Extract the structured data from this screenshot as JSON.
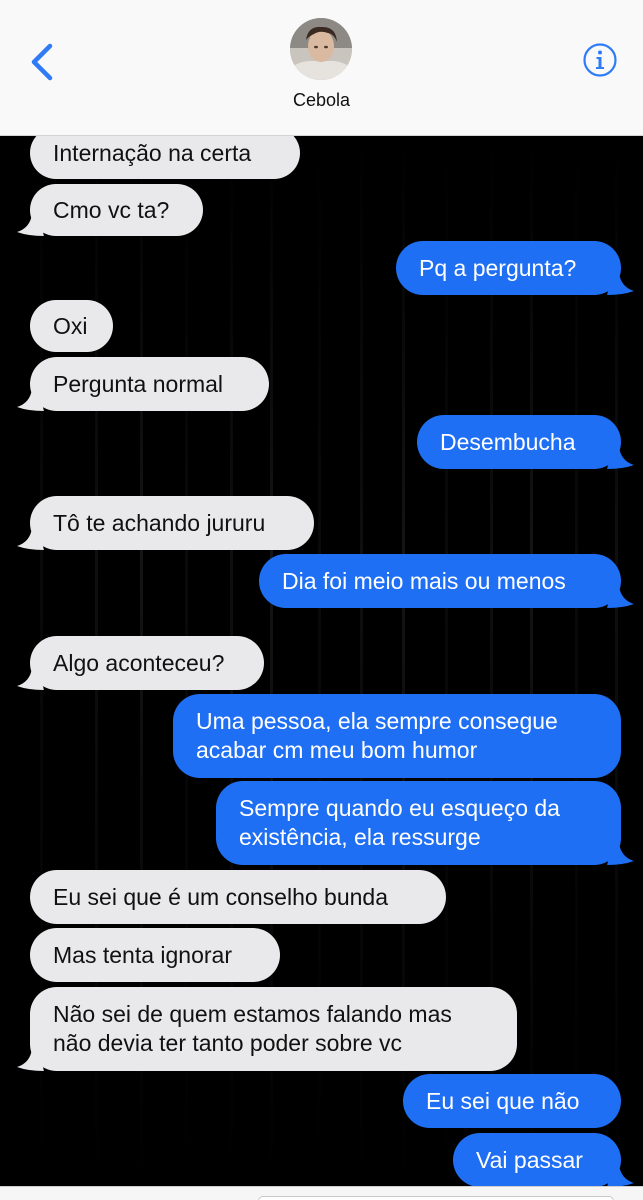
{
  "header": {
    "contact_name": "Cebola",
    "back_icon": "chevron-left-icon",
    "info_icon": "info-icon",
    "accent": "#2f7cf6"
  },
  "messages": [
    {
      "side": "in",
      "text": "Internação na certa"
    },
    {
      "side": "in",
      "text": "Cmo vc ta?"
    },
    {
      "side": "out",
      "text": "Pq a pergunta?"
    },
    {
      "side": "in",
      "text": "Oxi"
    },
    {
      "side": "in",
      "text": "Pergunta normal"
    },
    {
      "side": "out",
      "text": "Desembucha"
    },
    {
      "side": "in",
      "text": "Tô te achando jururu"
    },
    {
      "side": "out",
      "text": "Dia foi meio mais ou menos"
    },
    {
      "side": "in",
      "text": "Algo aconteceu?"
    },
    {
      "side": "out",
      "text": "Uma pessoa, ela sempre consegue acabar cm meu bom humor"
    },
    {
      "side": "out",
      "text": "Sempre quando eu esqueço da existência, ela ressurge"
    },
    {
      "side": "in",
      "text": "Eu sei que é um conselho bunda"
    },
    {
      "side": "in",
      "text": "Mas tenta ignorar"
    },
    {
      "side": "in",
      "text": "Não sei de quem estamos falando mas não devia ter tanto poder sobre vc"
    },
    {
      "side": "out",
      "text": "Eu sei que não"
    },
    {
      "side": "out",
      "text": "Vai passar"
    }
  ],
  "colors": {
    "incoming_bubble": "#e9e9eb",
    "outgoing_bubble": "#1f6ff5",
    "background": "#000000"
  }
}
